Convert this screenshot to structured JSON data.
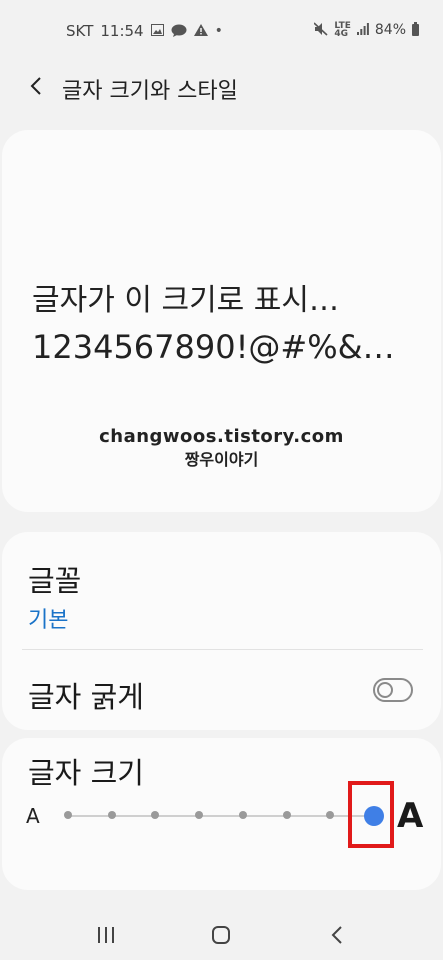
{
  "status_bar": {
    "carrier": "SKT",
    "time": "11:54",
    "network_top": "LTE",
    "network_bottom": "4G",
    "battery": "84%",
    "icons": [
      "image-icon",
      "chat-icon",
      "warning-icon",
      "mute-icon",
      "signal-icon",
      "battery-icon"
    ]
  },
  "header": {
    "title": "글자 크기와 스타일"
  },
  "preview": {
    "line1": "글자가 이 크기로 표시…",
    "line2": "1234567890!@#%&…",
    "watermark_line1": "changwoos.tistory.com",
    "watermark_line2": "짱우이야기"
  },
  "font": {
    "label": "글꼴",
    "value": "기본"
  },
  "bold": {
    "label": "글자 굵게",
    "enabled": false
  },
  "font_size": {
    "label": "글자 크기",
    "small_marker": "A",
    "large_marker": "A",
    "steps": 8,
    "selected_step": 8
  },
  "colors": {
    "accent": "#1a73c8",
    "slider_thumb": "#3f7fe6",
    "highlight_box": "#e11a1a"
  },
  "navigation": [
    "recents-icon",
    "home-icon",
    "back-icon"
  ]
}
